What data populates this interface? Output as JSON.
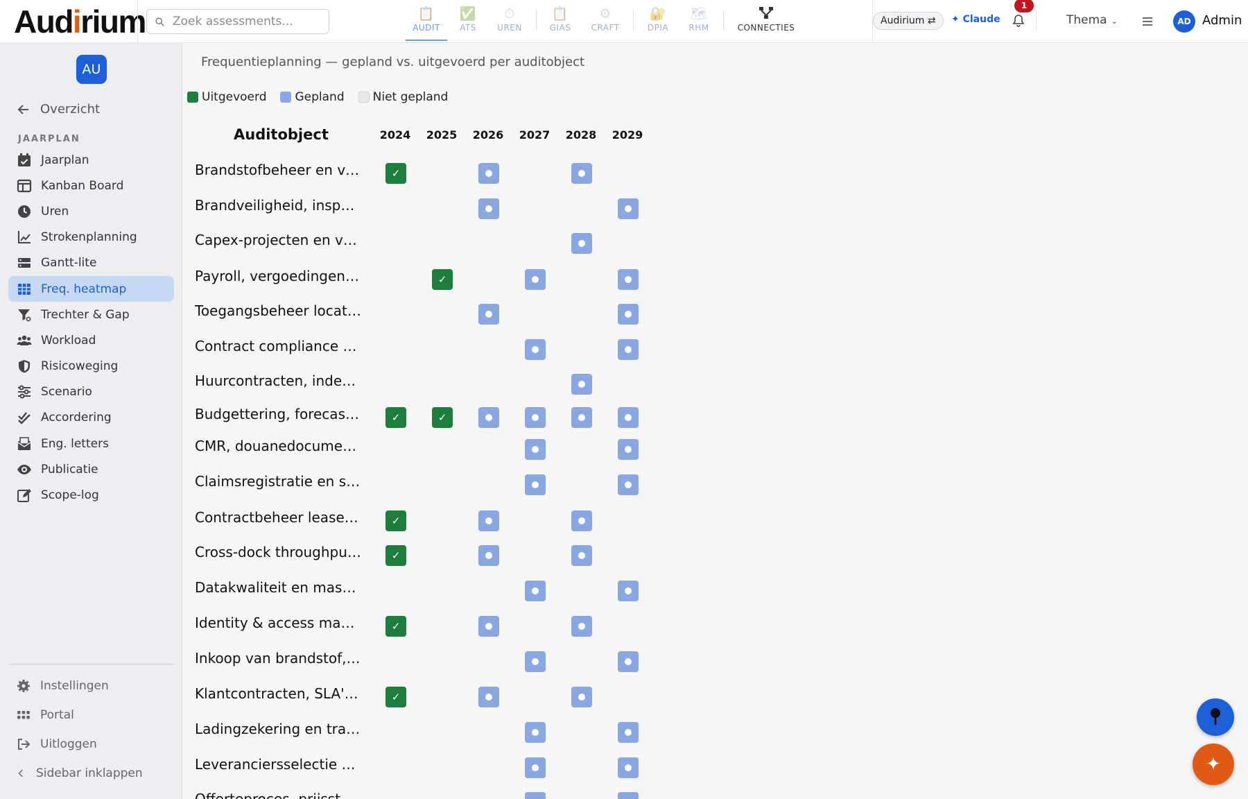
{
  "app": {
    "logo_main": "Aud",
    "logo_accent": "i",
    "logo_rest": "rium"
  },
  "search": {
    "placeholder": "Zoek assessments..."
  },
  "modules": [
    {
      "label": "AUDIT",
      "icon": "clipboard-icon",
      "active": true
    },
    {
      "label": "ATS",
      "icon": "check-icon"
    },
    {
      "label": "UREN",
      "icon": "stopwatch-icon"
    },
    {
      "label": "GIAS",
      "icon": "clipboard-icon"
    },
    {
      "label": "CRAFT",
      "icon": "gear-icon"
    },
    {
      "label": "DPIA",
      "icon": "lock-icon"
    },
    {
      "label": "RHM",
      "icon": "map-icon"
    },
    {
      "label": "CONNECTIES",
      "icon": "network-icon"
    }
  ],
  "topbar": {
    "tenant": "Audirium ⇄",
    "claude": "✦ Claude",
    "notifications": "1",
    "theme": "Thema",
    "avatar": "AD",
    "user": "Admin"
  },
  "sidebar": {
    "avatar": "AU",
    "back": "Overzicht",
    "section": "JAARPLAN",
    "items": [
      {
        "label": "Jaarplan",
        "icon": "calendar-check-icon"
      },
      {
        "label": "Kanban Board",
        "icon": "kanban-icon"
      },
      {
        "label": "Uren",
        "icon": "clock-icon"
      },
      {
        "label": "Strokenplanning",
        "icon": "line-chart-icon"
      },
      {
        "label": "Gantt-lite",
        "icon": "gantt-icon"
      },
      {
        "label": "Freq. heatmap",
        "icon": "grid-icon",
        "active": true
      },
      {
        "label": "Trechter & Gap",
        "icon": "funnel-icon"
      },
      {
        "label": "Workload",
        "icon": "users-icon"
      },
      {
        "label": "Risicoweging",
        "icon": "shield-icon"
      },
      {
        "label": "Scenario",
        "icon": "sliders-icon"
      },
      {
        "label": "Accordering",
        "icon": "double-check-icon"
      },
      {
        "label": "Eng. letters",
        "icon": "envelope-icon"
      },
      {
        "label": "Publicatie",
        "icon": "eye-icon"
      },
      {
        "label": "Scope-log",
        "icon": "edit-icon"
      }
    ],
    "footer": [
      {
        "label": "Instellingen",
        "icon": "gear-icon"
      },
      {
        "label": "Portal",
        "icon": "apps-icon"
      },
      {
        "label": "Uitloggen",
        "icon": "logout-icon"
      },
      {
        "label": "Sidebar inklappen",
        "icon": "chevron-left-icon"
      }
    ]
  },
  "main": {
    "title": "Frequentieplanning — gepland vs. uitgevoerd per auditobject",
    "legend": {
      "done": "Uitgevoerd",
      "planned": "Gepland",
      "none": "Niet gepland"
    },
    "column_object": "Auditobject",
    "years": [
      "2024",
      "2025",
      "2026",
      "2027",
      "2028",
      "2029"
    ],
    "done_glyph": "✓",
    "rows": [
      {
        "label": "Brandstofbeheer en v…",
        "cells": [
          "done",
          "",
          "plan",
          "",
          "plan",
          ""
        ]
      },
      {
        "label": "Brandveiligheid, insp…",
        "cells": [
          "",
          "",
          "plan",
          "",
          "",
          "plan"
        ]
      },
      {
        "label": "Capex-projecten en v…",
        "cells": [
          "",
          "",
          "",
          "",
          "plan",
          ""
        ]
      },
      {
        "label": "Payroll, vergoedingen…",
        "cells": [
          "",
          "done",
          "",
          "plan",
          "",
          "plan"
        ]
      },
      {
        "label": "Toegangsbeheer locat…",
        "cells": [
          "",
          "",
          "plan",
          "",
          "",
          "plan"
        ]
      },
      {
        "label": "Contract compliance …",
        "cells": [
          "",
          "",
          "",
          "plan",
          "",
          "plan"
        ]
      },
      {
        "label": "Huurcontracten, inde…",
        "cells": [
          "",
          "",
          "",
          "",
          "plan",
          ""
        ]
      },
      {
        "label": "Budgettering, forecas…",
        "cells": [
          "done",
          "done",
          "plan",
          "plan",
          "plan",
          "plan"
        ]
      },
      {
        "label": "CMR, douanedocume…",
        "cells": [
          "",
          "",
          "",
          "plan",
          "",
          "plan"
        ]
      },
      {
        "label": "Claimsregistratie en s…",
        "cells": [
          "",
          "",
          "",
          "plan",
          "",
          "plan"
        ]
      },
      {
        "label": "Contractbeheer lease…",
        "cells": [
          "done",
          "",
          "plan",
          "",
          "plan",
          ""
        ]
      },
      {
        "label": "Cross-dock throughpu…",
        "cells": [
          "done",
          "",
          "plan",
          "",
          "plan",
          ""
        ]
      },
      {
        "label": "Datakwaliteit en mas…",
        "cells": [
          "",
          "",
          "",
          "plan",
          "",
          "plan"
        ]
      },
      {
        "label": "Identity & access ma…",
        "cells": [
          "done",
          "",
          "plan",
          "",
          "plan",
          ""
        ]
      },
      {
        "label": "Inkoop van brandstof,…",
        "cells": [
          "",
          "",
          "",
          "plan",
          "",
          "plan"
        ]
      },
      {
        "label": "Klantcontracten, SLA'…",
        "cells": [
          "done",
          "",
          "plan",
          "",
          "plan",
          ""
        ]
      },
      {
        "label": "Ladingzekering en tra…",
        "cells": [
          "",
          "",
          "",
          "plan",
          "",
          "plan"
        ]
      },
      {
        "label": "Leveranciersselectie …",
        "cells": [
          "",
          "",
          "",
          "plan",
          "",
          "plan"
        ]
      },
      {
        "label": "Offerteproces, prijsst…",
        "cells": [
          "",
          "",
          "",
          "plan",
          "",
          "plan"
        ]
      }
    ]
  }
}
